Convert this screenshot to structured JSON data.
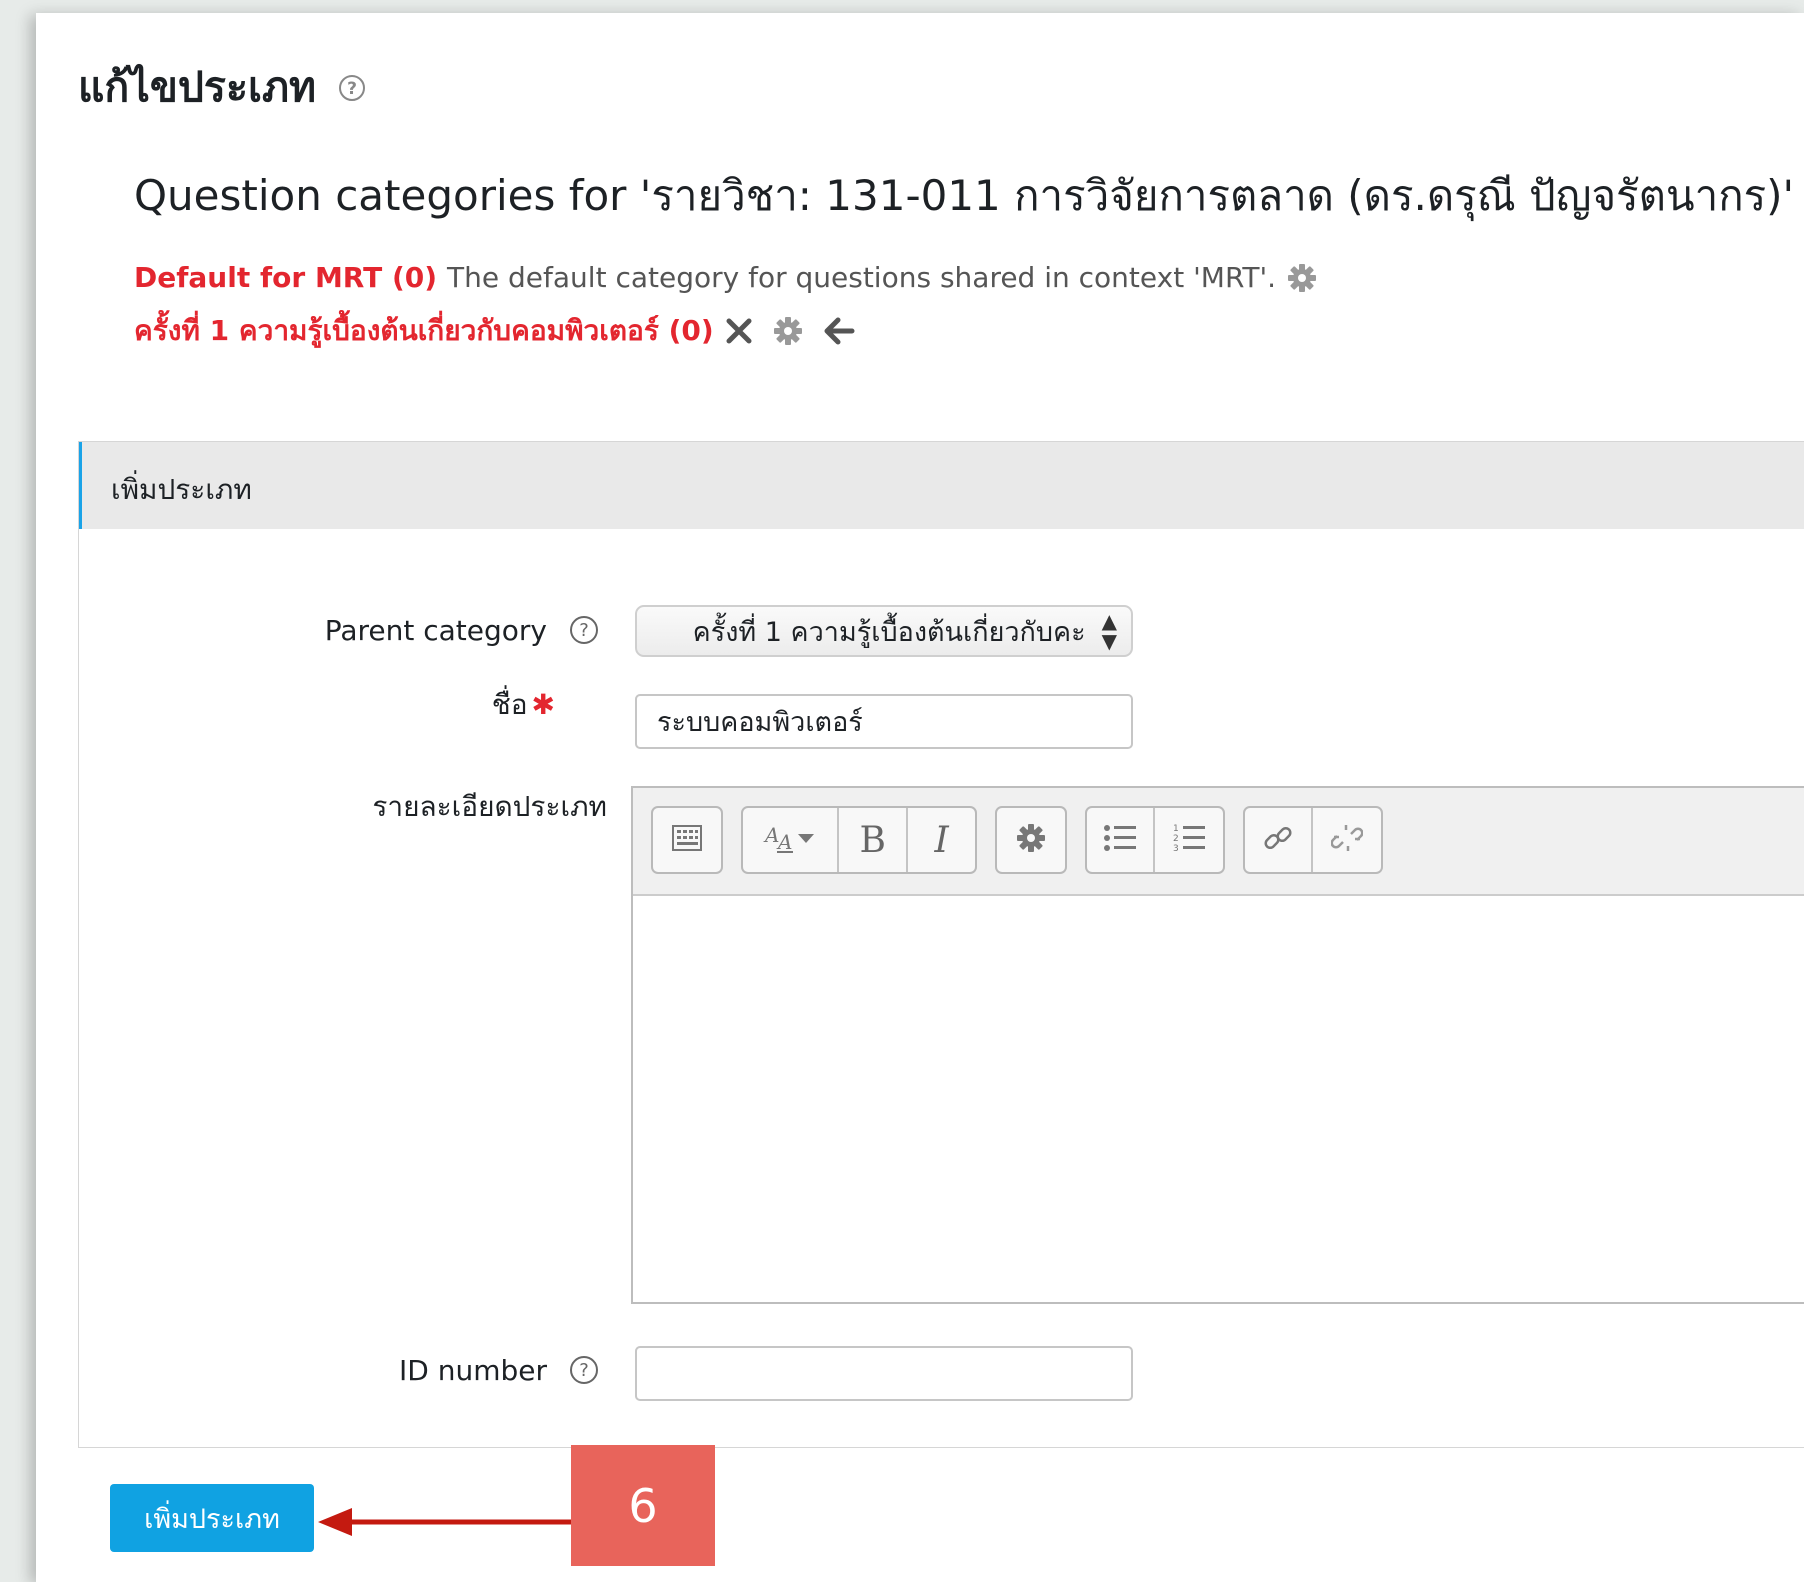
{
  "heading": {
    "title": "แก้ไขประเภท"
  },
  "subheading": "Question categories for 'รายวิชา: 131-011 การวิจัยการตลาด (ดร.ดรุณี ปัญจรัตนากร)'",
  "categories": [
    {
      "name": "Default for MRT (0)",
      "description": "The default category for questions shared in context 'MRT'."
    },
    {
      "name": "ครั้งที่ 1 ความรู้เบื้องต้นเกี่ยวกับคอมพิวเตอร์ (0)",
      "description": ""
    }
  ],
  "form": {
    "legend": "เพิ่มประเภท",
    "parent_label": "Parent category",
    "parent_value": "ครั้งที่ 1 ความรู้เบื้องต้นเกี่ยวกับคะ",
    "name_label": "ชื่อ",
    "name_value": "ระบบคอมพิวเตอร์",
    "desc_label": "รายละเอียดประเภท",
    "idnumber_label": "ID number",
    "idnumber_value": "",
    "submit_label": "เพิ่มประเภท"
  },
  "toolbar": {
    "bold_label": "B",
    "italic_label": "I"
  },
  "annotation": {
    "step_number": "6"
  },
  "colors": {
    "accent": "#10a2e2",
    "link_red": "#e3262f",
    "annotation": "#e8645b",
    "arrow": "#c41a10"
  },
  "icons": [
    "help-icon",
    "gear-icon",
    "delete-icon",
    "arrow-left-icon",
    "toolbar-toggle-icon",
    "font-style-icon",
    "bold-icon",
    "italic-icon",
    "settings-icon",
    "bullet-list-icon",
    "numbered-list-icon",
    "link-icon",
    "unlink-icon"
  ]
}
